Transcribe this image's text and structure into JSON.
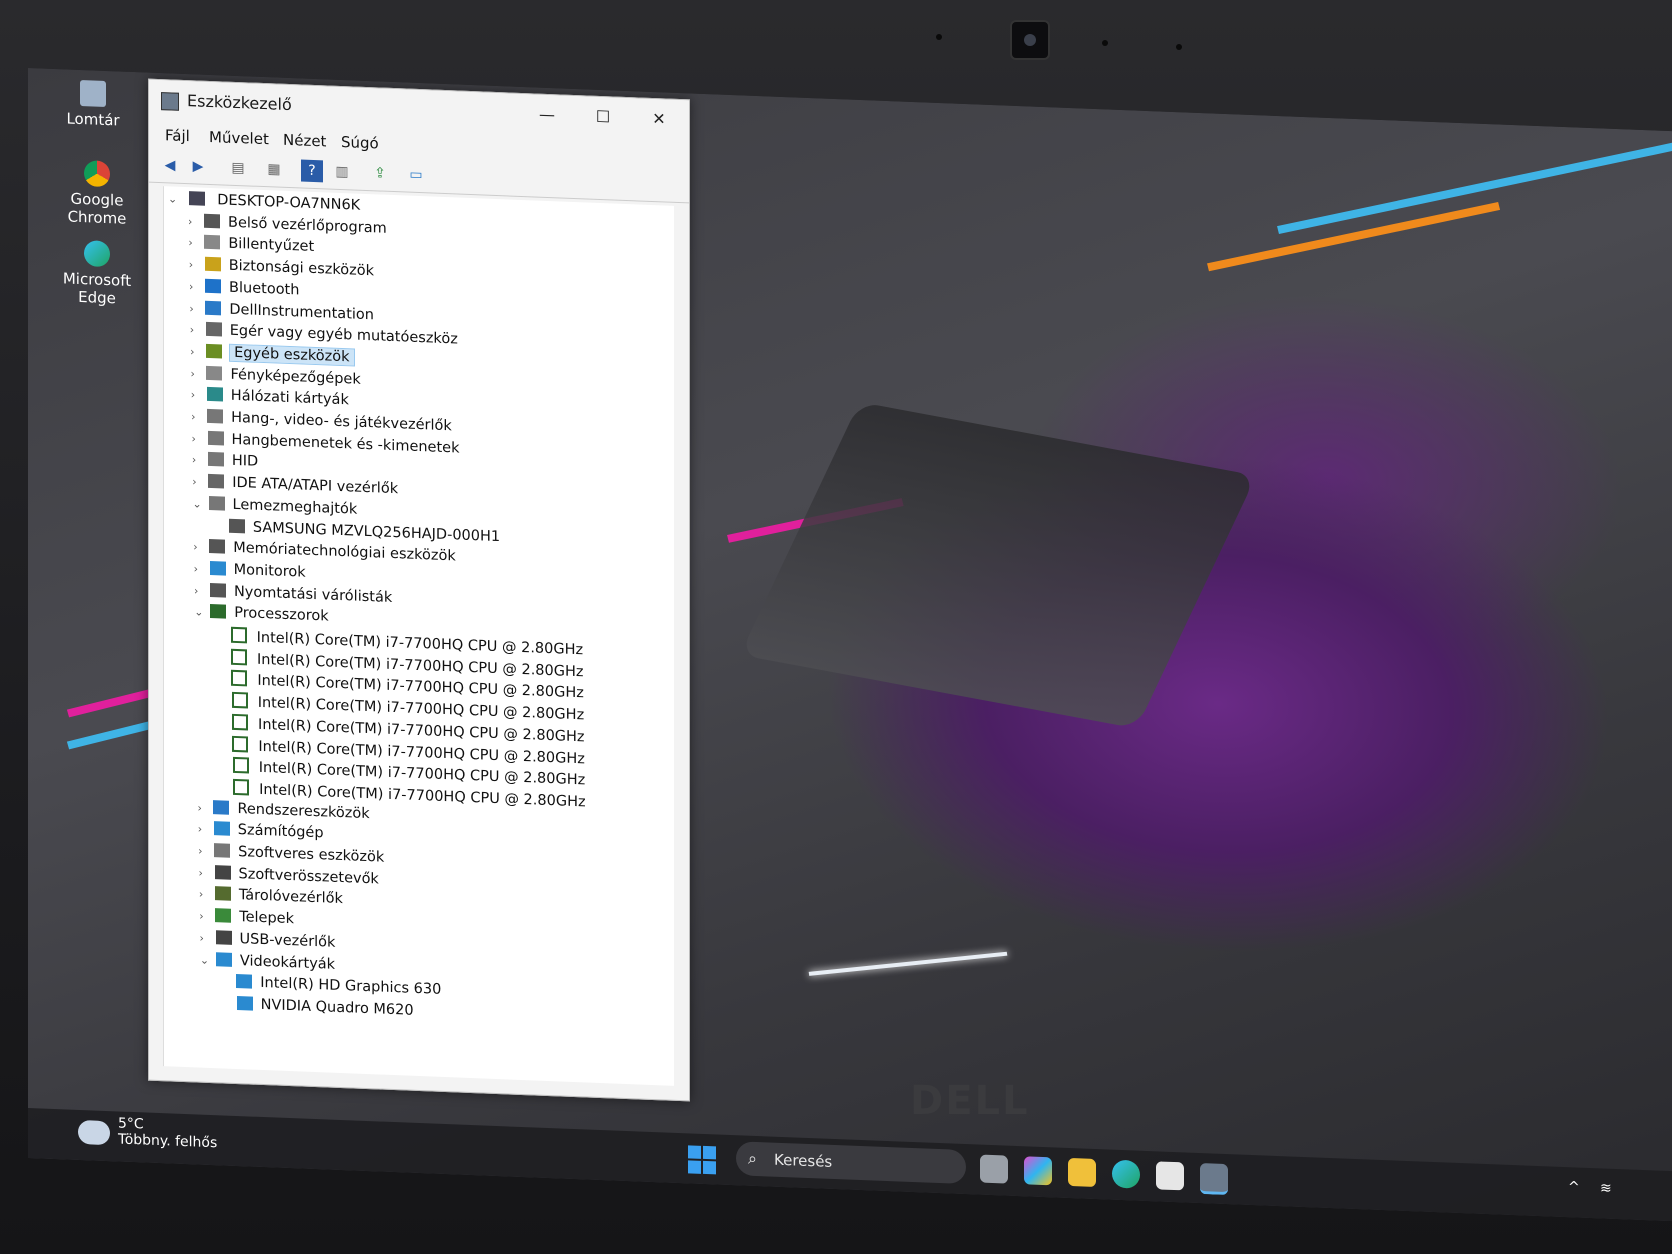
{
  "desktop": {
    "icons": [
      {
        "label": "Lomtár"
      },
      {
        "label": "Google Chrome"
      },
      {
        "label": "Microsoft Edge"
      }
    ]
  },
  "window": {
    "title": "Eszközkezelő",
    "controls": {
      "minimize": "—",
      "maximize": "☐",
      "close": "✕"
    },
    "menu": [
      "Fájl",
      "Művelet",
      "Nézet",
      "Súgó"
    ]
  },
  "tree": {
    "root": "DESKTOP-OA7NN6K",
    "categories": [
      {
        "label": "Belső vezérlőprogram",
        "expanded": false
      },
      {
        "label": "Billentyűzet",
        "expanded": false
      },
      {
        "label": "Biztonsági eszközök",
        "expanded": false
      },
      {
        "label": "Bluetooth",
        "expanded": false
      },
      {
        "label": "DellInstrumentation",
        "expanded": false
      },
      {
        "label": "Egér vagy egyéb mutatóeszköz",
        "expanded": false
      },
      {
        "label": "Egyéb eszközök",
        "expanded": false,
        "selected": true
      },
      {
        "label": "Fényképezőgépek",
        "expanded": false
      },
      {
        "label": "Hálózati kártyák",
        "expanded": false
      },
      {
        "label": "Hang-, video- és játékvezérlők",
        "expanded": false
      },
      {
        "label": "Hangbemenetek és -kimenetek",
        "expanded": false
      },
      {
        "label": "HID",
        "expanded": false
      },
      {
        "label": "IDE ATA/ATAPI vezérlők",
        "expanded": false
      },
      {
        "label": "Lemezmeghajtók",
        "expanded": true
      },
      {
        "label": "SAMSUNG MZVLQ256HAJD-000H1",
        "child": true
      },
      {
        "label": "Memóriatechnológiai eszközök",
        "expanded": false
      },
      {
        "label": "Monitorok",
        "expanded": false
      },
      {
        "label": "Nyomtatási várólisták",
        "expanded": false
      },
      {
        "label": "Processzorok",
        "expanded": true
      },
      {
        "label": "Intel(R) Core(TM) i7-7700HQ CPU @ 2.80GHz",
        "child": true,
        "cpu": true
      },
      {
        "label": "Intel(R) Core(TM) i7-7700HQ CPU @ 2.80GHz",
        "child": true,
        "cpu": true
      },
      {
        "label": "Intel(R) Core(TM) i7-7700HQ CPU @ 2.80GHz",
        "child": true,
        "cpu": true
      },
      {
        "label": "Intel(R) Core(TM) i7-7700HQ CPU @ 2.80GHz",
        "child": true,
        "cpu": true
      },
      {
        "label": "Intel(R) Core(TM) i7-7700HQ CPU @ 2.80GHz",
        "child": true,
        "cpu": true
      },
      {
        "label": "Intel(R) Core(TM) i7-7700HQ CPU @ 2.80GHz",
        "child": true,
        "cpu": true
      },
      {
        "label": "Intel(R) Core(TM) i7-7700HQ CPU @ 2.80GHz",
        "child": true,
        "cpu": true
      },
      {
        "label": "Intel(R) Core(TM) i7-7700HQ CPU @ 2.80GHz",
        "child": true,
        "cpu": true
      },
      {
        "label": "Rendszereszközök",
        "expanded": false
      },
      {
        "label": "Számítógép",
        "expanded": false
      },
      {
        "label": "Szoftveres eszközök",
        "expanded": false
      },
      {
        "label": "Szoftverösszetevők",
        "expanded": false
      },
      {
        "label": "Tárolóvezérlők",
        "expanded": false
      },
      {
        "label": "Telepek",
        "expanded": false
      },
      {
        "label": "USB-vezérlők",
        "expanded": false
      },
      {
        "label": "Videokártyák",
        "expanded": true
      },
      {
        "label": "Intel(R) HD Graphics 630",
        "child": true
      },
      {
        "label": "NVIDIA Quadro M620",
        "child": true
      }
    ]
  },
  "taskbar": {
    "weather": {
      "temp": "5°C",
      "condition": "Többny. felhős"
    },
    "search_placeholder": "Keresés"
  },
  "brand": "DELL",
  "colors": {
    "accent": "#3aa0f0",
    "selection": "#cce4f7",
    "cpu_icon": "#2c6b2c"
  }
}
